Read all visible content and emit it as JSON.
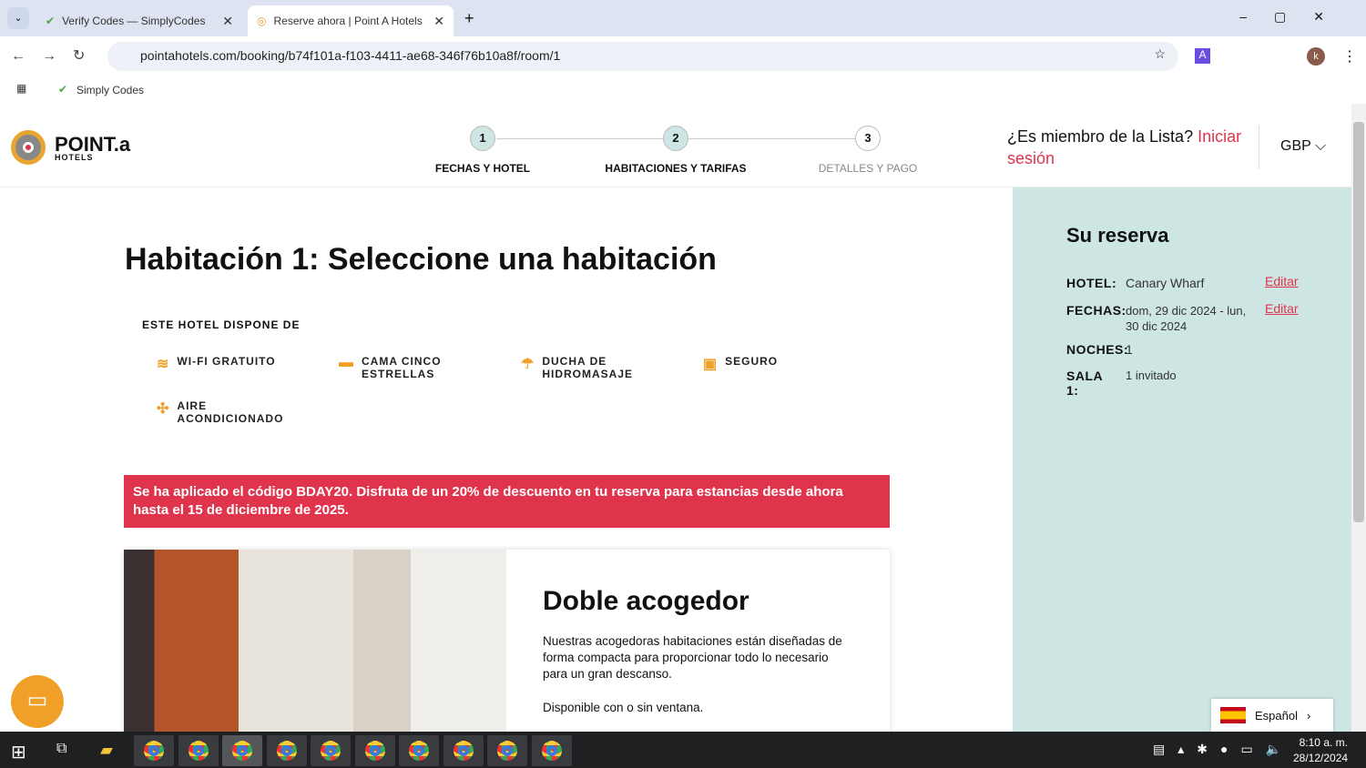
{
  "browser": {
    "tabs": [
      {
        "title": "Verify Codes — SimplyCodes"
      },
      {
        "title": "Reserve ahora | Point A Hotels"
      }
    ],
    "url": "pointahotels.com/booking/b74f101a-f103-4411-ae68-346f76b10a8f/room/1",
    "bookmark": "Simply Codes",
    "profile_initial": "k"
  },
  "header": {
    "logo": "POINT.a",
    "logo_sub": "HOTELS",
    "steps": [
      {
        "num": "1",
        "label": "FECHAS Y HOTEL"
      },
      {
        "num": "2",
        "label": "HABITACIONES Y TARIFAS"
      },
      {
        "num": "3",
        "label": "DETALLES Y PAGO"
      }
    ],
    "member_q": "¿Es miembro de la Lista?",
    "login": "Iniciar sesión",
    "currency": "GBP"
  },
  "main": {
    "title": "Habitación 1: Seleccione una habitación",
    "amenities_title": "ESTE HOTEL DISPONE DE",
    "amenities": [
      {
        "label": "WI-FI GRATUITO",
        "icon": "wifi-icon"
      },
      {
        "label": "CAMA CINCO ESTRELLAS",
        "icon": "bed-icon"
      },
      {
        "label": "DUCHA DE HIDROMASAJE",
        "icon": "shower-icon"
      },
      {
        "label": "SEGURO",
        "icon": "safe-icon"
      },
      {
        "label": "AIRE ACONDICIONADO",
        "icon": "fan-icon"
      }
    ],
    "promo": "Se ha aplicado el código BDAY20. Disfruta de un 20% de descuento en tu reserva para estancias desde ahora hasta el 15 de diciembre de 2025.",
    "room": {
      "name": "Doble acogedor",
      "desc": "Nuestras acogedoras habitaciones están diseñadas de forma compacta para proporcionar todo lo necesario para un gran descanso.",
      "note": "Disponible con o sin ventana."
    }
  },
  "summary": {
    "title": "Su reserva",
    "hotel_label": "HOTEL:",
    "hotel": "Canary Wharf",
    "dates_label": "FECHAS:",
    "dates": "dom, 29 dic 2024 - lun, 30 dic 2024",
    "nights_label": "NOCHES:",
    "nights": "1",
    "room_label": "SALA 1:",
    "guests": "1 invitado",
    "edit": "Editar"
  },
  "language": "Español",
  "taskbar": {
    "time": "8:10 a. m.",
    "date": "28/12/2024"
  }
}
